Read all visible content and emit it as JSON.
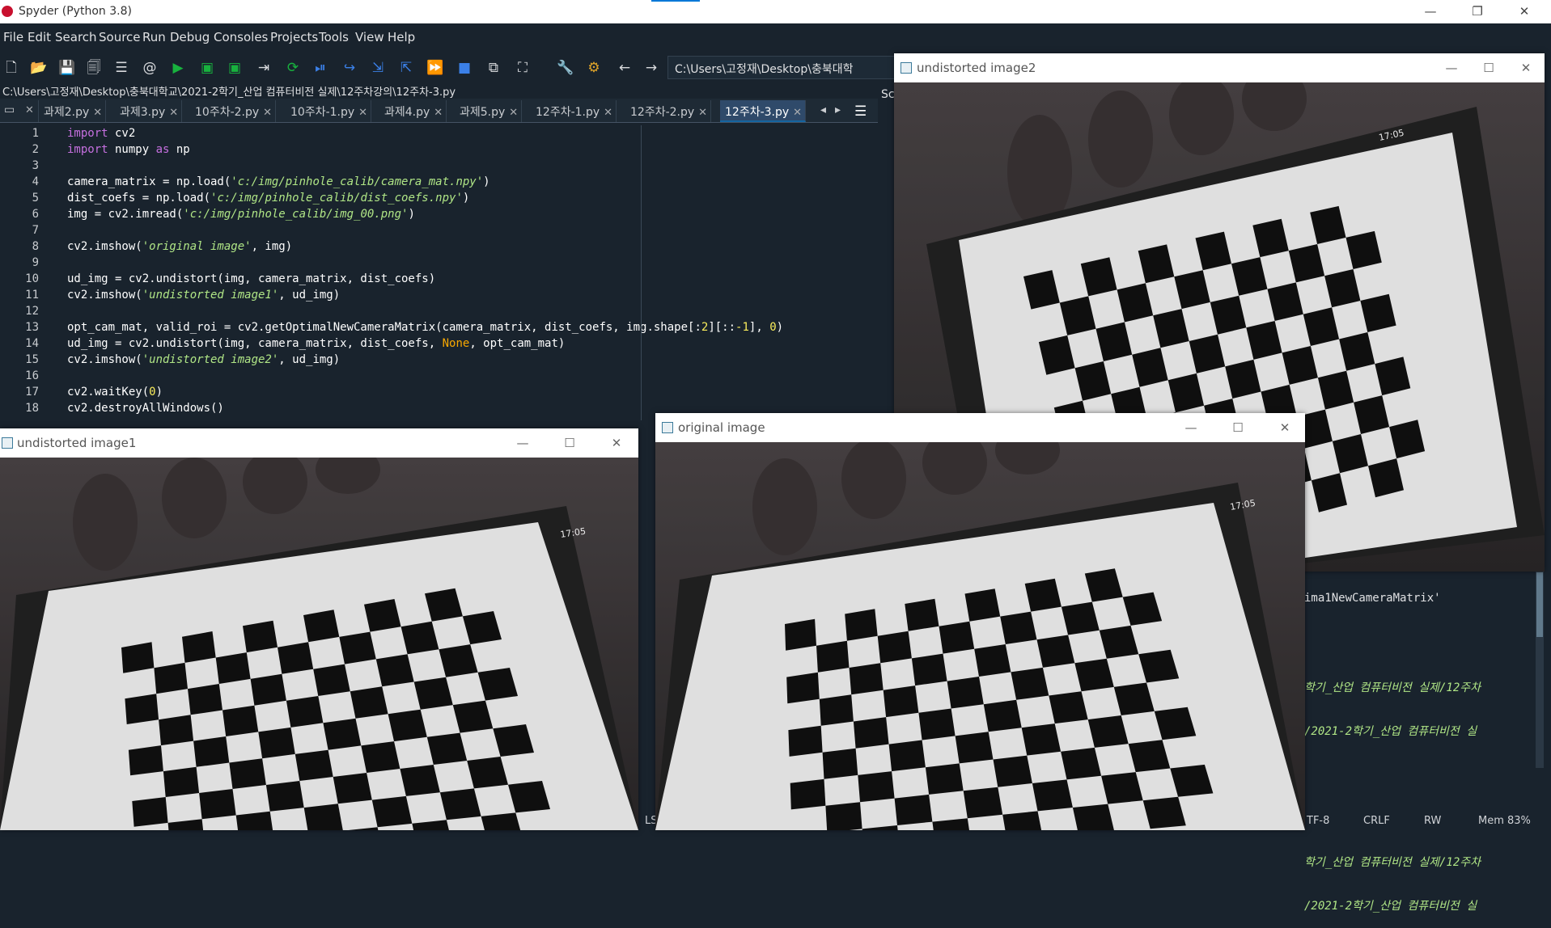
{
  "app": {
    "title": "Spyder (Python 3.8)",
    "window_controls": {
      "minimize": "—",
      "restore": "❐",
      "close": "✕"
    }
  },
  "menu": [
    "File",
    "Edit",
    "Search",
    "Source",
    "Run",
    "Debug",
    "Consoles",
    "Projects",
    "Tools",
    "View",
    "Help"
  ],
  "toolbar": {
    "path": "C:\\Users\\고정재\\Desktop\\충북대학"
  },
  "editor": {
    "file_path": "C:\\Users\\고정재\\Desktop\\충북대학교\\2021-2학기_산업 컴퓨터비전 실제\\12주차강의\\12주차-3.py",
    "tabs": [
      {
        "label": "과제2.py",
        "active": false
      },
      {
        "label": "과제3.py",
        "active": false
      },
      {
        "label": "10주차-2.py",
        "active": false
      },
      {
        "label": "10주차-1.py",
        "active": false
      },
      {
        "label": "과제4.py",
        "active": false
      },
      {
        "label": "과제5.py",
        "active": false
      },
      {
        "label": "12주차-1.py",
        "active": false
      },
      {
        "label": "12주차-2.py",
        "active": false
      },
      {
        "label": "12주차-3.py",
        "active": true
      }
    ],
    "line_numbers": [
      "1",
      "2",
      "3",
      "4",
      "5",
      "6",
      "7",
      "8",
      "9",
      "10",
      "11",
      "12",
      "13",
      "14",
      "15",
      "16",
      "17",
      "18"
    ],
    "lines": [
      "import cv2",
      "import numpy as np",
      "",
      "camera_matrix = np.load('c:/img/pinhole_calib/camera_mat.npy')",
      "dist_coefs = np.load('c:/img/pinhole_calib/dist_coefs.npy')",
      "img = cv2.imread('c:/img/pinhole_calib/img_00.png')",
      "",
      "cv2.imshow('original image', img)",
      "",
      "ud_img = cv2.undistort(img, camera_matrix, dist_coefs)",
      "cv2.imshow('undistorted image1', ud_img)",
      "",
      "opt_cam_mat, valid_roi = cv2.getOptimalNewCameraMatrix(camera_matrix, dist_coefs, img.shape[:2][::-1], 0)",
      "ud_img = cv2.undistort(img, camera_matrix, dist_coefs, None, opt_cam_mat)",
      "cv2.imshow('undistorted image2', ud_img)",
      "",
      "cv2.waitKey(0)",
      "cv2.destroyAllWindows()"
    ]
  },
  "right_pane": {
    "label": "Sc"
  },
  "console": {
    "lines": [
      "ima1NewCameraMatrix'",
      "",
      "학기_산업 컴퓨터비전 실제/12주차",
      "/2021-2학기_산업 컴퓨터비전 실",
      "",
      "",
      "학기_산업 컴퓨터비전 실제/12주차",
      "/2021-2학기_산업 컴퓨터비전 실"
    ]
  },
  "status": {
    "ls": "LS",
    "encoding": "TF-8",
    "eol": "CRLF",
    "rw": "RW",
    "mem": "Mem 83%"
  },
  "windows": {
    "undistorted2": {
      "title": "undistorted image2"
    },
    "undistorted1": {
      "title": "undistorted image1"
    },
    "original": {
      "title": "original image"
    },
    "phone": {
      "time": "17:05"
    },
    "controls": {
      "minimize": "—",
      "maximize": "☐",
      "close": "✕"
    }
  }
}
